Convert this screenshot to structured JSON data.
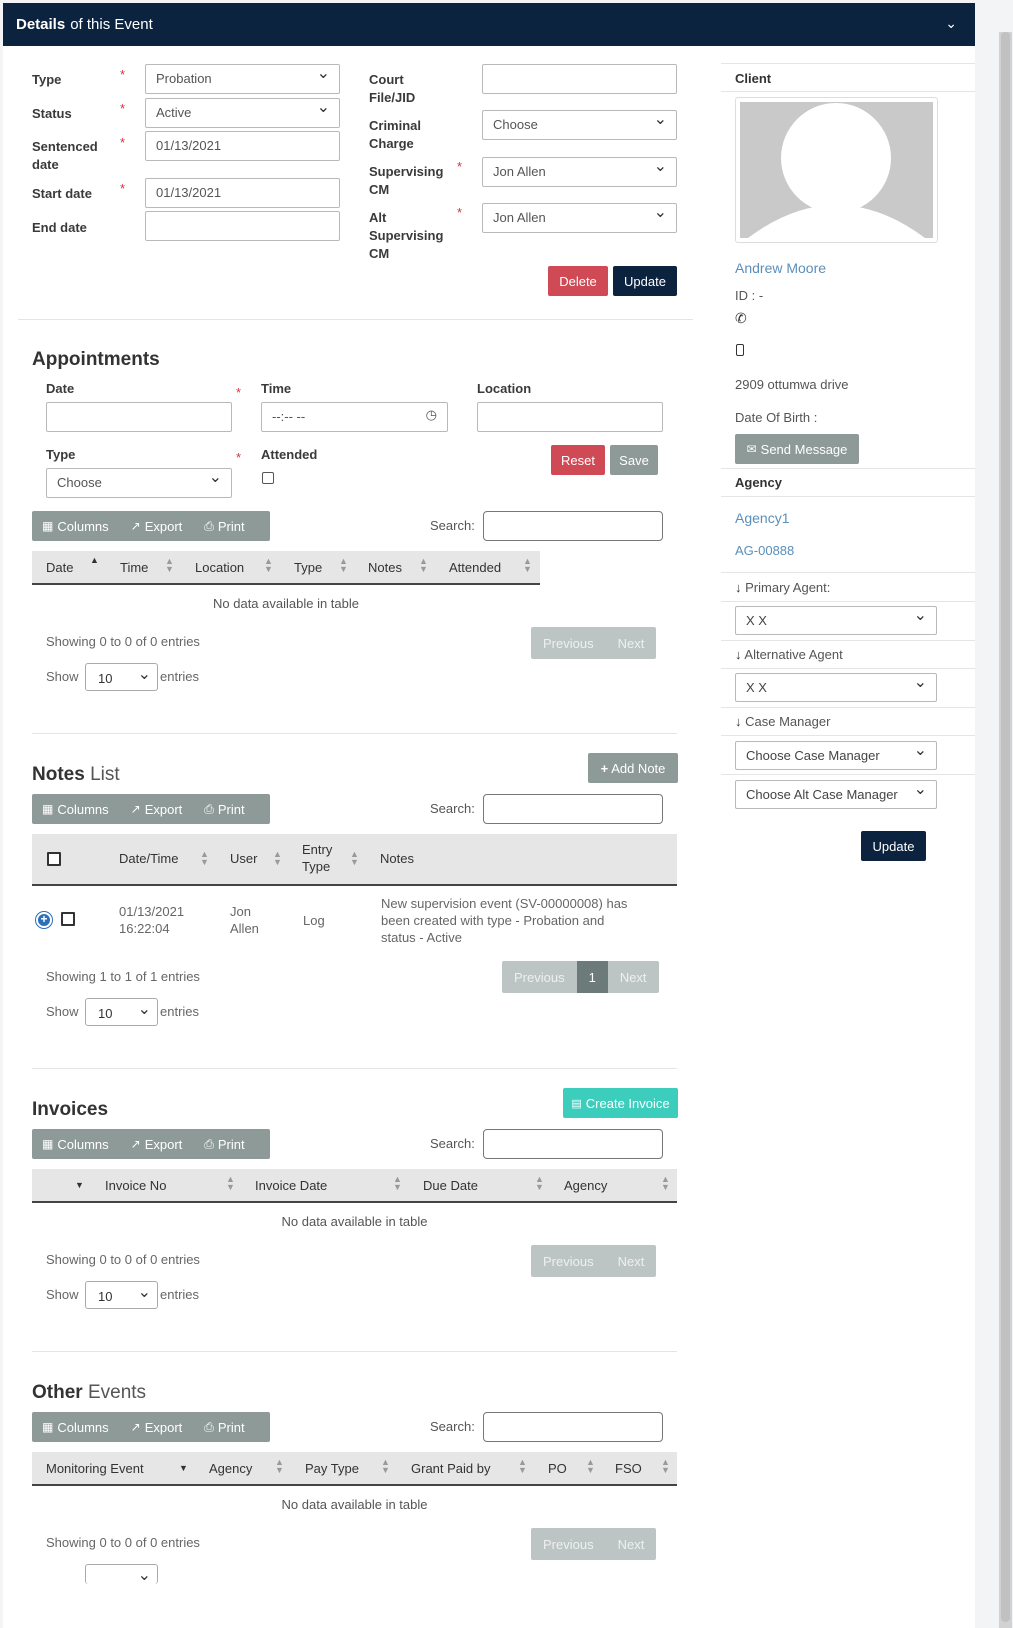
{
  "header": {
    "title_bold": "Details",
    "title_rest": "of this Event"
  },
  "details": {
    "type_label": "Type",
    "type_value": "Probation",
    "status_label": "Status",
    "status_value": "Active",
    "sentenced_label_1": "Sentenced",
    "sentenced_label_2": "date",
    "sentenced_value": "01/13/2021",
    "start_label": "Start date",
    "start_value": "01/13/2021",
    "end_label": "End date",
    "end_value": "",
    "court_label_1": "Court",
    "court_label_2": "File/JID",
    "court_value": "",
    "charge_label_1": "Criminal",
    "charge_label_2": "Charge",
    "charge_value": "Choose",
    "sup_label_1": "Supervising",
    "sup_label_2": "CM",
    "sup_value": "Jon Allen",
    "alt_label_1": "Alt",
    "alt_label_2": "Supervising",
    "alt_label_3": "CM",
    "alt_value": "Jon Allen",
    "required": "*",
    "delete_label": "Delete",
    "update_label": "Update"
  },
  "appointments": {
    "title": "Appointments",
    "date_label": "Date",
    "time_label": "Time",
    "time_placeholder": "--:-- --",
    "location_label": "Location",
    "type_label": "Type",
    "type_value": "Choose",
    "attended_label": "Attended",
    "reset_label": "Reset",
    "save_label": "Save",
    "columns": [
      "Date",
      "Time",
      "Location",
      "Type",
      "Notes",
      "Attended"
    ],
    "nodata": "No data available in table",
    "info": "Showing 0 to 0 of 0 entries"
  },
  "toolbar": {
    "columns": "Columns",
    "export": "Export",
    "print": "Print",
    "search": "Search:"
  },
  "pager": {
    "previous": "Previous",
    "next": "Next",
    "page": "1"
  },
  "show": {
    "show": "Show",
    "value": "10",
    "entries": "entries"
  },
  "notes": {
    "title_bold": "Notes",
    "title_rest": "List",
    "add_label": "Add Note",
    "columns": [
      "Date/Time",
      "User",
      "Entry",
      "Type",
      "Notes"
    ],
    "row": {
      "date": "01/13/2021",
      "time": "16:22:04",
      "user_1": "Jon",
      "user_2": "Allen",
      "entry_type": "Log",
      "note_1": "New supervision event (SV-00000008) has",
      "note_2": "been created with type - Probation and",
      "note_3": "status - Active"
    },
    "info": "Showing 1 to 1 of 1 entries"
  },
  "invoices": {
    "title": "Invoices",
    "create_label": "Create Invoice",
    "columns": [
      "Invoice No",
      "Invoice Date",
      "Due Date",
      "Agency"
    ],
    "nodata": "No data available in table",
    "info": "Showing 0 to 0 of 0 entries"
  },
  "other": {
    "title_bold": "Other",
    "title_rest": "Events",
    "columns": [
      "Monitoring Event",
      "Agency",
      "Pay Type",
      "Grant Paid by",
      "PO",
      "FSO"
    ],
    "nodata": "No data available in table",
    "info": "Showing 0 to 0 of 0 entries"
  },
  "client": {
    "section": "Client",
    "name": "Andrew Moore",
    "id": "ID : -",
    "address": "2909 ottumwa drive",
    "dob": "Date Of Birth :",
    "send_label": "Send Message"
  },
  "agency": {
    "section": "Agency",
    "name": "Agency1",
    "code": "AG-00888",
    "primary_label": "Primary Agent:",
    "primary_value": "X X",
    "alt_label": "Alternative Agent",
    "alt_value": "X X",
    "cm_label": "Case Manager",
    "cm_value": "Choose Case Manager",
    "alt_cm_value": "Choose Alt Case Manager",
    "update_label": "Update"
  },
  "colors": {
    "navy": "#0c2340",
    "red": "#cf4a55",
    "grey": "#8e9a98",
    "teal": "#3dcdbd",
    "link": "#5b8fb9"
  }
}
